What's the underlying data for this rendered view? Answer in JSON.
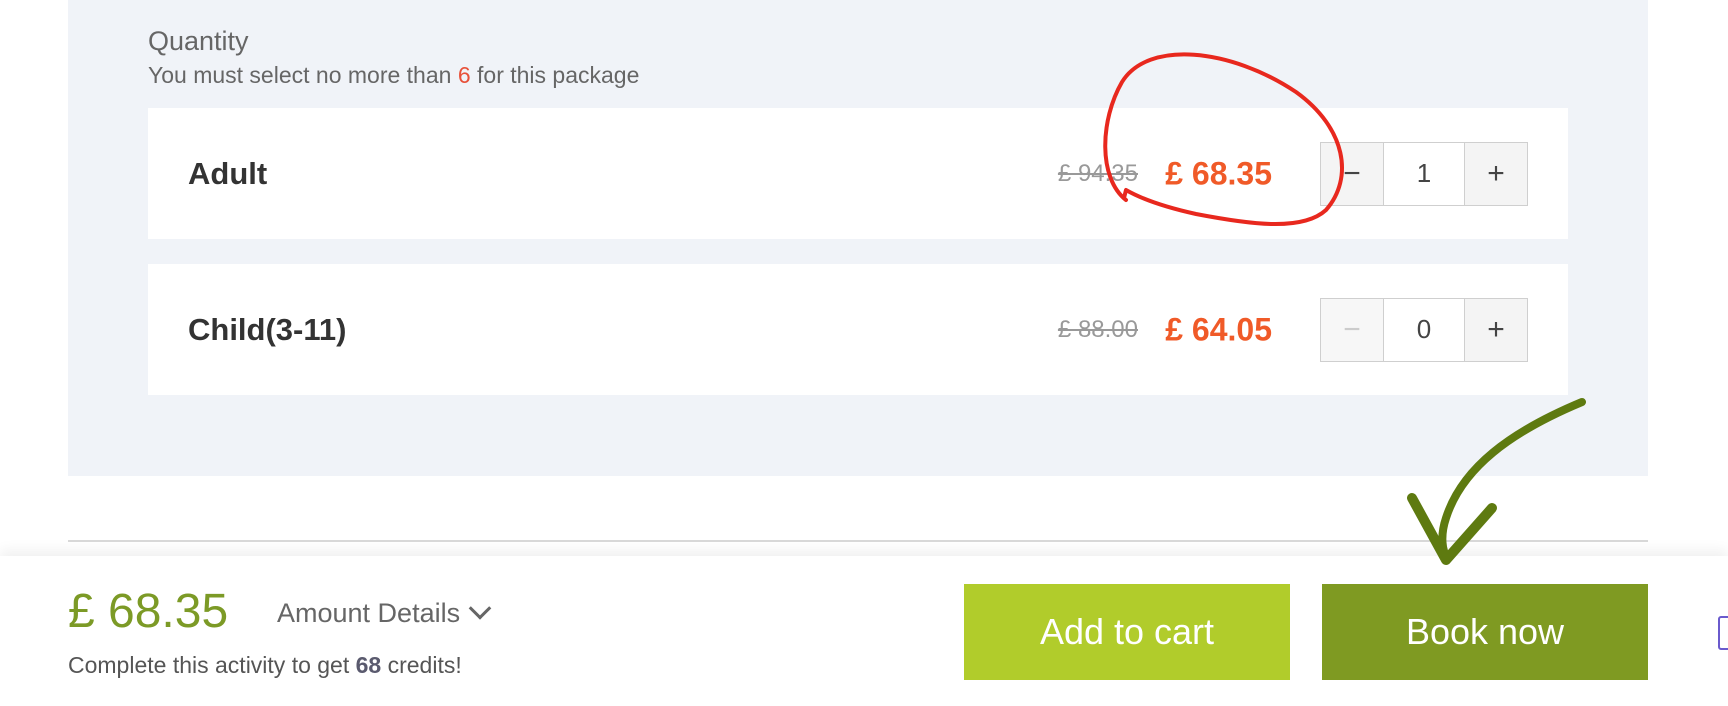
{
  "quantity": {
    "title": "Quantity",
    "note_prefix": "You must select no more than ",
    "note_limit": "6",
    "note_suffix": " for this package"
  },
  "tickets": [
    {
      "label": "Adult",
      "old_price": "£ 94.35",
      "new_price": "£ 68.35",
      "quantity": "1",
      "minus": "−",
      "plus": "+"
    },
    {
      "label": "Child(3-11)",
      "old_price": "£ 88.00",
      "new_price": "£ 64.05",
      "quantity": "0",
      "minus": "−",
      "plus": "+"
    }
  ],
  "footer": {
    "total": "£ 68.35",
    "amount_details_label": "Amount Details",
    "credits_prefix": "Complete this activity to get ",
    "credits_value": "68",
    "credits_suffix": " credits!",
    "add_to_cart_label": "Add to cart",
    "book_now_label": "Book now"
  },
  "colors": {
    "price_accent": "#f05a28",
    "total_green": "#7c9a26",
    "add_to_cart_bg": "#b1cc2b",
    "book_now_bg": "#7f9a22",
    "annotation_red": "#e8281e",
    "annotation_arrow": "#5e7a10"
  }
}
